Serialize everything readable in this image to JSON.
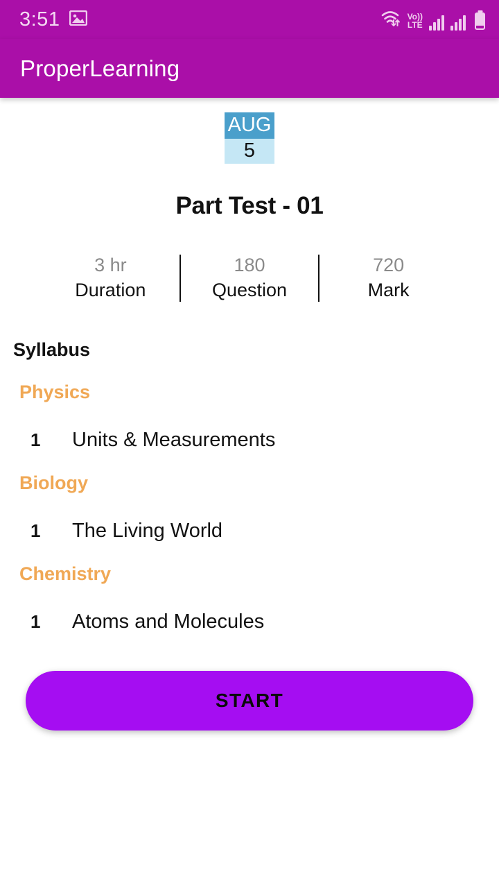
{
  "statusbar": {
    "time": "3:51",
    "photo_icon": "photo-icon",
    "wifi_icon": "wifi-data-icon",
    "volte_top": "Vo))",
    "volte_bottom": "LTE",
    "signal_icon_1": "signal-bars-icon",
    "signal_icon_2": "signal-bars-icon",
    "battery_icon": "battery-icon"
  },
  "appbar": {
    "title": "ProperLearning",
    "background": "#AA0FA8"
  },
  "exam": {
    "date_month": "AUG",
    "date_day": "5",
    "title": "Part Test - 01",
    "stats": [
      {
        "value": "3 hr",
        "label": "Duration"
      },
      {
        "value": "180",
        "label": "Question"
      },
      {
        "value": "720",
        "label": "Mark"
      }
    ]
  },
  "syllabus": {
    "heading": "Syllabus",
    "subject_color": "#F0A855",
    "subjects": [
      {
        "name": "Physics",
        "topics": [
          {
            "num": "1",
            "name": "Units & Measurements"
          }
        ]
      },
      {
        "name": "Biology",
        "topics": [
          {
            "num": "1",
            "name": "The Living World"
          }
        ]
      },
      {
        "name": "Chemistry",
        "topics": [
          {
            "num": "1",
            "name": "Atoms and Molecules"
          }
        ]
      }
    ]
  },
  "actions": {
    "start_label": "START",
    "start_color": "#A50DF2"
  }
}
